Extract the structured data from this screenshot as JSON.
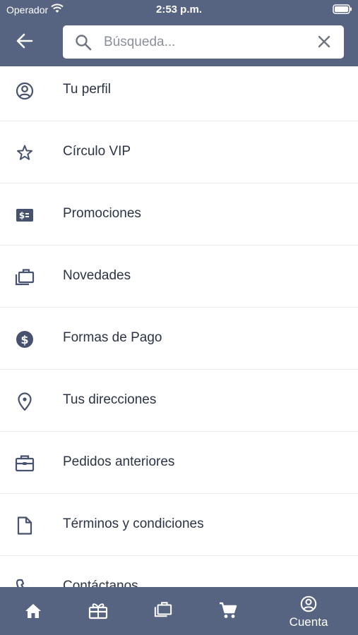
{
  "status_bar": {
    "carrier": "Operador",
    "time": "2:53 p.m."
  },
  "header": {
    "back_icon": "arrow-left-icon",
    "search": {
      "placeholder": "Búsqueda...",
      "value": "",
      "clear_icon": "close-icon"
    }
  },
  "menu": {
    "items": [
      {
        "label": "Tu perfil",
        "icon": "user-circle-icon"
      },
      {
        "label": "Círculo VIP",
        "icon": "star-icon"
      },
      {
        "label": "Promociones",
        "icon": "ticket-icon"
      },
      {
        "label": "Novedades",
        "icon": "briefcase-stack-icon"
      },
      {
        "label": "Formas de Pago",
        "icon": "dollar-circle-icon"
      },
      {
        "label": "Tus direcciones",
        "icon": "map-pin-icon"
      },
      {
        "label": "Pedidos anteriores",
        "icon": "toolbox-icon"
      },
      {
        "label": "Términos y condiciones",
        "icon": "document-icon"
      },
      {
        "label": "Contáctanos",
        "icon": "phone-icon"
      }
    ]
  },
  "tab_bar": {
    "tabs": [
      {
        "icon": "home-icon",
        "label": ""
      },
      {
        "icon": "gift-icon",
        "label": ""
      },
      {
        "icon": "briefcase-stack-icon",
        "label": ""
      },
      {
        "icon": "cart-icon",
        "label": ""
      },
      {
        "icon": "user-circle-icon",
        "label": "Cuenta"
      }
    ]
  },
  "colors": {
    "header_bg": "#566381",
    "icon": "#47526e",
    "text": "#2b3445"
  }
}
